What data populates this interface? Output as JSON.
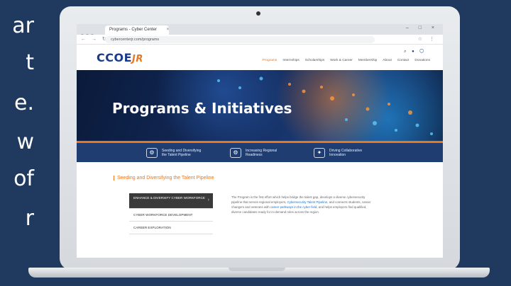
{
  "slide": {
    "text_fragments": [
      "ar",
      "t",
      "e.",
      "w",
      "of",
      "r"
    ]
  },
  "browser": {
    "tab_title": "Programs - Cyber Center",
    "tab_close": "×",
    "url": "cybercenterjr.com/programs",
    "window_controls": "–  □  ×",
    "nav_icons": "← → ↻",
    "addr_icons": "☆ ⋮"
  },
  "site": {
    "logo_main": "CCOE",
    "logo_suffix": "JR",
    "header_icons": "⌕ ● ◯",
    "menu": [
      {
        "label": "Programs",
        "active": true
      },
      {
        "label": "Internships"
      },
      {
        "label": "Scholarships"
      },
      {
        "label": "Work & Career"
      },
      {
        "label": "Membership"
      },
      {
        "label": "About"
      },
      {
        "label": "Contact"
      },
      {
        "label": "Donations"
      }
    ],
    "hero_title": "Programs & Initiatives",
    "pillars": [
      {
        "icon": "network-icon",
        "glyph": "⚙",
        "label": "Seeding and Diversifying the Talent Pipeline"
      },
      {
        "icon": "gear-icon",
        "glyph": "⚙",
        "label": "Increasing Regional Readiness"
      },
      {
        "icon": "handshake-icon",
        "glyph": "✦",
        "label": "Driving Collaborative Innovation"
      }
    ],
    "section_title": "Seeding and Diversifying the Talent Pipeline",
    "sidenav": [
      {
        "label": "ENHANCE & DIVERSIFY CYBER WORKFORCE",
        "active": true
      },
      {
        "label": "CYBER WORKFORCE DEVELOPMENT"
      },
      {
        "label": "CAREER EXPLORATION"
      }
    ],
    "body": {
      "p1": "The Program is the first effort which helps bridge the talent gap, develops a diverse cybersecurity pipeline that serves regional employers,",
      "link1": "Cybersecurity Talent Pipeline,",
      "p2": "and connects students, career changers and veterans with",
      "link2": "career pathways in the cyber field,",
      "p3": "and helps employers find qualified, diverse candidates ready for in-demand roles across the region."
    },
    "colors": {
      "accent": "#e87722",
      "brand": "#1a3b8c",
      "band": "#203d72",
      "background": "#1f3a5e"
    }
  }
}
